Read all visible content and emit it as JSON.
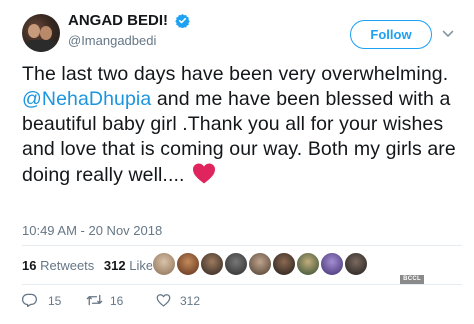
{
  "user": {
    "display_name": "ANGAD BEDI!",
    "handle": "@Imangadbedi",
    "verified": true,
    "follow_label": "Follow"
  },
  "tweet": {
    "text_before_mention": "The last two days have been very overwhelming. ",
    "mention": "@NehaDhupia",
    "text_after_mention": " and me have been blessed with a beautiful baby girl .Thank you all for your wishes and love that is coming our way. Both my girls are doing really well....",
    "emoji": "red-heart",
    "timestamp": "10:49 AM - 20 Nov 2018"
  },
  "stats": {
    "retweets_count": "16",
    "retweets_label": "Retweets",
    "likes_count": "312",
    "likes_label": "Likes"
  },
  "actions": {
    "reply_count": "15",
    "retweet_count": "16",
    "like_count": "312"
  },
  "watermark": "BCCL",
  "colors": {
    "accent": "#1da1f2",
    "mention": "#1b95e0",
    "heart": "#e0245e",
    "muted": "#657786"
  }
}
